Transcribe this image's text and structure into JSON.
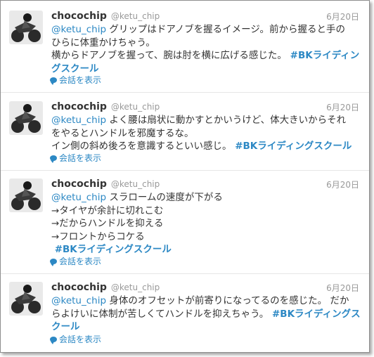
{
  "tweets": [
    {
      "user": "chocochip",
      "handle": "@ketu_chip",
      "date": "6月20日",
      "mention": "@ketu_chip",
      "text_line1": " グリップはドアノブを握るイメージ。前から握ると手の",
      "text_rest": "ひらに体重かけちゃう。\n横からドアノブを握って、腕は肘を横に広げる感じた。",
      "hashtag": " #BKライディングスクール",
      "convo_label": "会話を表示"
    },
    {
      "user": "chocochip",
      "handle": "@ketu_chip",
      "date": "6月20日",
      "mention": "@ketu_chip",
      "text_line1": " よく腰は扇状に動かすとかいうけど、体大きいからそれ",
      "text_rest": "をやるとハンドルを邪魔するな。\nイン側の斜め後ろを意識するといい感じ。",
      "hashtag": " #BKライディングスクール",
      "convo_label": "会話を表示"
    },
    {
      "user": "chocochip",
      "handle": "@ketu_chip",
      "date": "6月20日",
      "mention": "@ketu_chip",
      "text_line1": " スラロームの速度が下がる",
      "text_rest": "→タイヤが余計に切れこむ\n→だからハンドルを抑える\n→フロントからコケる\n",
      "hashtag": " #BKライディングスクール",
      "convo_label": "会話を表示"
    },
    {
      "user": "chocochip",
      "handle": "@ketu_chip",
      "date": "6月20日",
      "mention": "@ketu_chip",
      "text_line1": " 身体のオフセットが前寄りになってるのを感じた。 だか",
      "text_rest": "らよけいに体制が苦しくてハンドルを抑えちゃう。",
      "hashtag": " #BKライディングスクール",
      "convo_label": "会話を表示"
    }
  ],
  "colors": {
    "link": "#2c88c4",
    "meta": "#999999",
    "text": "#333333"
  },
  "icons": {
    "conversation": "speech-bubble-icon",
    "avatar": "motorcycle-rider-avatar"
  }
}
